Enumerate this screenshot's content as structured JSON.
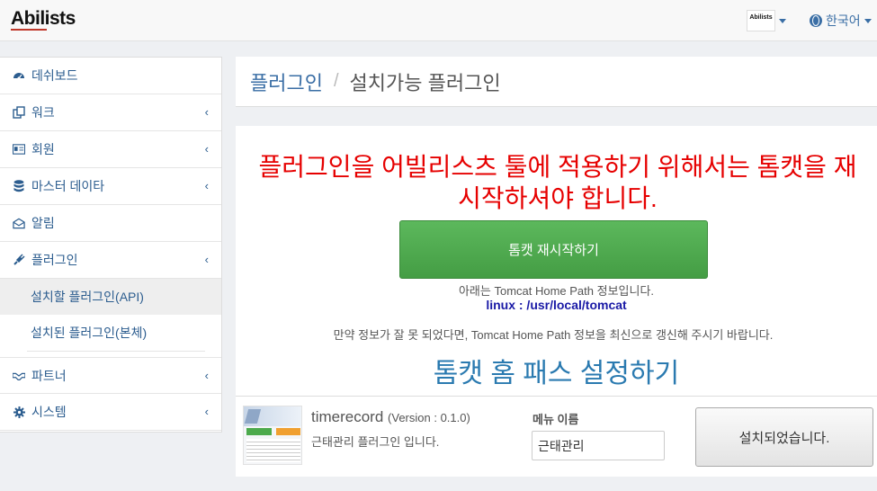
{
  "header": {
    "logo_main": "Abi",
    "logo_lists": "lists",
    "avatar_text": "Abilists",
    "language": "한국어"
  },
  "sidebar": {
    "items": [
      {
        "label": "데쉬보드",
        "icon": "dashboard-icon"
      },
      {
        "label": "워크",
        "icon": "copy-icon"
      },
      {
        "label": "회원",
        "icon": "id-card-icon"
      },
      {
        "label": "마스터 데이타",
        "icon": "database-icon"
      },
      {
        "label": "알림",
        "icon": "envelope-open-icon"
      },
      {
        "label": "플러그인",
        "icon": "plug-icon"
      },
      {
        "label": "파트너",
        "icon": "handshake-icon"
      },
      {
        "label": "시스템",
        "icon": "gear-icon"
      }
    ],
    "sub_items": [
      {
        "label": "설치할 플러그인(API)"
      },
      {
        "label": "설치된 플러그인(본체)"
      }
    ]
  },
  "breadcrumb": {
    "parent": "플러그인",
    "separator": "/",
    "current": "설치가능 플러그인"
  },
  "main": {
    "warning": "플러그인을 어빌리스츠 툴에 적용하기 위해서는 톰캣을 재시작하셔야 합니다.",
    "restart_button": "톰캣 재시작하기",
    "home_path_info": "아래는 Tomcat Home Path 정보입니다.",
    "home_path_value": "linux : /usr/local/tomcat",
    "update_notice": "만약 정보가 잘 못 되었다면, Tomcat Home Path 정보을 최신으로 갱신해 주시기 바랍니다.",
    "home_setting_link": "톰캣 홈 패스 설정하기"
  },
  "plugin": {
    "name": "timerecord",
    "version": "(Version : 0.1.0)",
    "description": "근태관리 플러그인 입니다.",
    "menu_label": "메뉴 이름",
    "menu_value": "근태관리",
    "installed_button": "설치되었습니다."
  },
  "colors": {
    "accent": "#3a6ea5",
    "warning": "#e60000",
    "success": "#5cb85c",
    "path": "#1a1aa6"
  }
}
